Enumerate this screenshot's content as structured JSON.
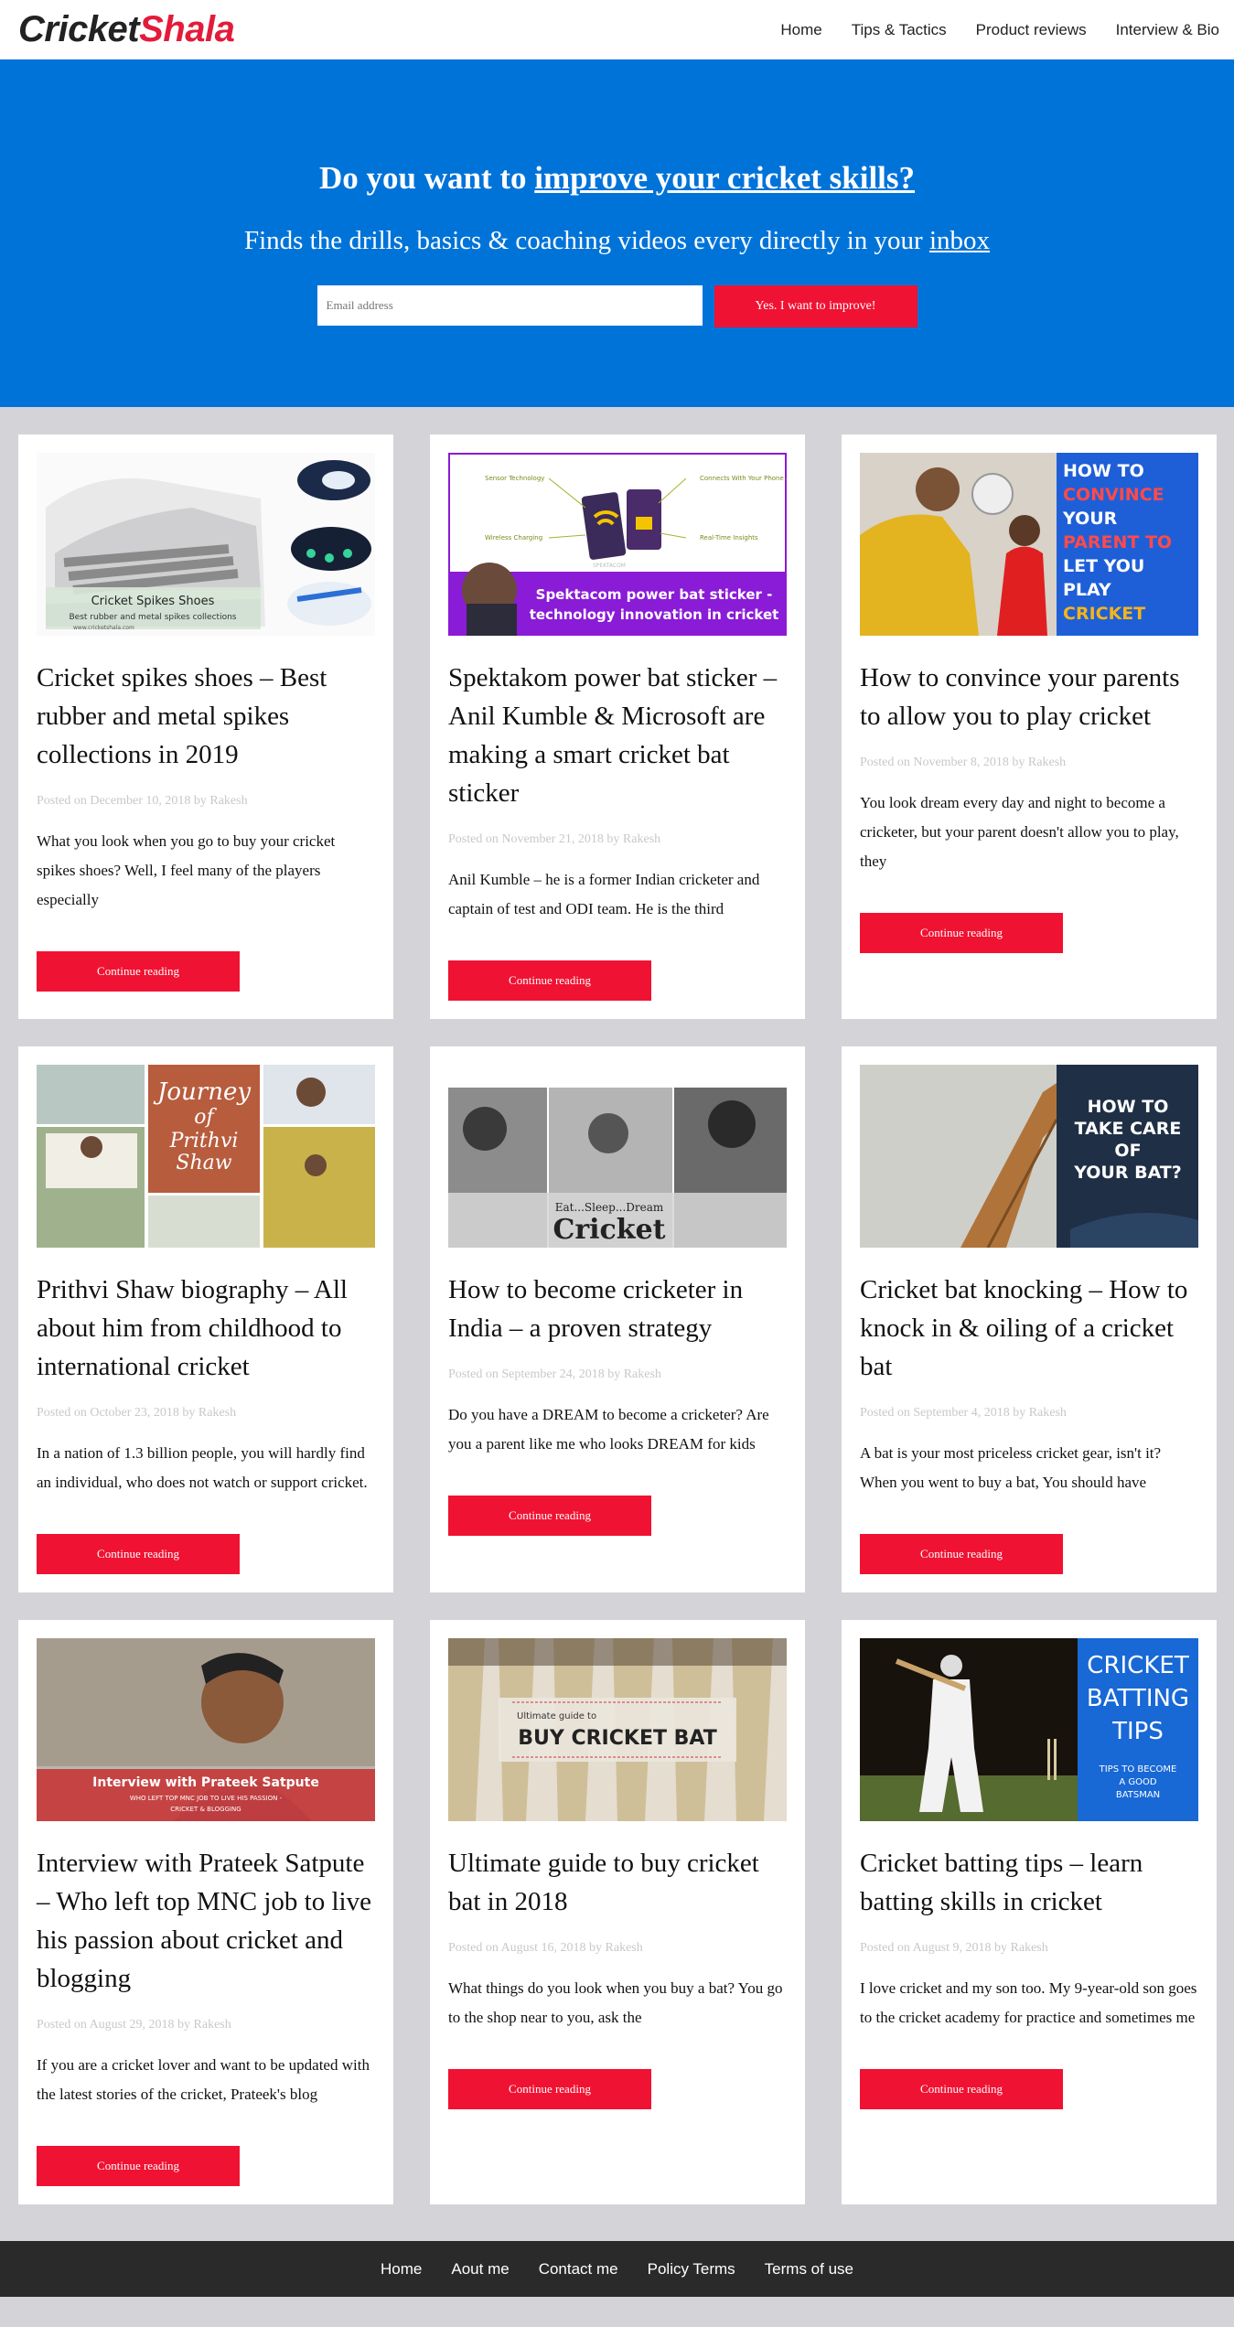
{
  "brand": {
    "part1": "Cricket",
    "part2": "Shala"
  },
  "nav": [
    "Home",
    "Tips & Tactics",
    "Product reviews",
    "Interview & Bio"
  ],
  "hero": {
    "title_prefix": "Do you want to ",
    "title_link": "improve your cricket skills?",
    "subtitle_prefix": "Finds the drills, basics & coaching videos every directly in your ",
    "subtitle_link": "inbox",
    "email_placeholder": "Email address",
    "submit_label": "Yes. I want to improve!"
  },
  "colors": {
    "hero_bg": "#0073d9",
    "accent": "#f01232",
    "page_bg": "#d3d3d8",
    "footer_bg": "#2a2a2a"
  },
  "posts": [
    {
      "title": "Cricket spikes shoes – Best rubber and metal spikes collections in 2019",
      "meta": "Posted on December 10, 2018 by Rakesh",
      "excerpt": "What you look when you go to buy your cricket spikes shoes? Well, I feel many of the players especially",
      "button": "Continue reading",
      "image": {
        "kind": "shoes",
        "caption": "Cricket Spikes Shoes",
        "subcaption": "Best rubber and metal spikes collections",
        "site": "www.cricketshala.com"
      }
    },
    {
      "title": "Spektakom power bat sticker – Anil Kumble & Microsoft are making a smart cricket bat sticker",
      "meta": "Posted on November 21, 2018 by Rakesh",
      "excerpt": "Anil Kumble – he is a former Indian cricketer and captain of test and ODI team. He is the third",
      "button": "Continue reading",
      "image": {
        "kind": "sticker",
        "line1": "Spektacom power bat sticker -",
        "line2": "technology innovation in cricket",
        "labels": [
          "Sensor Technology",
          "Connects With Your Phone App",
          "Wireless Charging",
          "Real-Time Insights"
        ],
        "sticker_text": "SPEKTACOM"
      }
    },
    {
      "title": "How to convince your parents to allow you to play cricket",
      "meta": "Posted on November 8, 2018 by Rakesh",
      "excerpt": "You look dream every day and night to become a cricketer, but your parent doesn't allow you to play, they",
      "button": "Continue reading",
      "image": {
        "kind": "parents",
        "lines": [
          "HOW TO",
          "CONVINCE",
          "YOUR",
          "PARENT TO",
          "LET YOU",
          "PLAY",
          "CRICKET"
        ]
      }
    },
    {
      "title": "Prithvi Shaw biography – All about him from childhood to international cricket",
      "meta": "Posted on October 23, 2018 by Rakesh",
      "excerpt": "In a nation of 1.3 billion people, you will hardly find an individual, who does not watch or support cricket.",
      "button": "Continue reading",
      "image": {
        "kind": "prithvi",
        "lines": [
          "Journey",
          "of",
          "Prithvi",
          "Shaw"
        ]
      }
    },
    {
      "title": "How to become cricketer in India – a proven strategy",
      "meta": "Posted on September 24, 2018 by Rakesh",
      "excerpt": "Do you have a DREAM to become a cricketer? Are you a parent like me who looks DREAM for kids",
      "button": "Continue reading",
      "image": {
        "kind": "dream",
        "tagline": "Eat...Sleep...Dream",
        "word": "Cricket"
      }
    },
    {
      "title": "Cricket bat knocking – How to knock in & oiling of a cricket bat",
      "meta": "Posted on September 4, 2018 by Rakesh",
      "excerpt": "A bat is your most priceless cricket gear, isn't it? When you went to buy a bat, You should have",
      "button": "Continue reading",
      "image": {
        "kind": "batcare",
        "lines": [
          "HOW TO",
          "TAKE CARE",
          "OF",
          "YOUR BAT?"
        ]
      }
    },
    {
      "title": "Interview with Prateek Satpute – Who left top MNC job to live his passion about cricket and blogging",
      "meta": "Posted on August 29, 2018 by Rakesh",
      "excerpt": "If you are a cricket lover and want to be updated with the latest stories of the cricket, Prateek's blog",
      "button": "Continue reading",
      "image": {
        "kind": "interview",
        "line1": "Interview with Prateek Satpute",
        "line2": "WHO LEFT TOP MNC JOB TO LIVE HIS PASSION -",
        "line3": "CRICKET & BLOGGING"
      }
    },
    {
      "title": "Ultimate guide to buy cricket bat in 2018",
      "meta": "Posted on August 16, 2018 by Rakesh",
      "excerpt": "What things do you look when you buy a bat? You go to the shop near to you, ask the",
      "button": "Continue reading",
      "image": {
        "kind": "buybat",
        "small": "Ultimate guide to",
        "big": "BUY CRICKET BAT"
      }
    },
    {
      "title": "Cricket batting tips – learn batting skills in cricket",
      "meta": "Posted on August 9, 2018 by Rakesh",
      "excerpt": "I love cricket and my son too. My 9-year-old son goes to the cricket academy for practice and sometimes me",
      "button": "Continue reading",
      "image": {
        "kind": "batting",
        "lines": [
          "CRICKET",
          "BATTING",
          "TIPS"
        ],
        "sub": [
          "TIPS TO BECOME",
          "A GOOD",
          "BATSMAN"
        ]
      }
    }
  ],
  "footer": [
    "Home",
    "Aout me",
    "Contact me",
    "Policy Terms",
    "Terms of use"
  ]
}
